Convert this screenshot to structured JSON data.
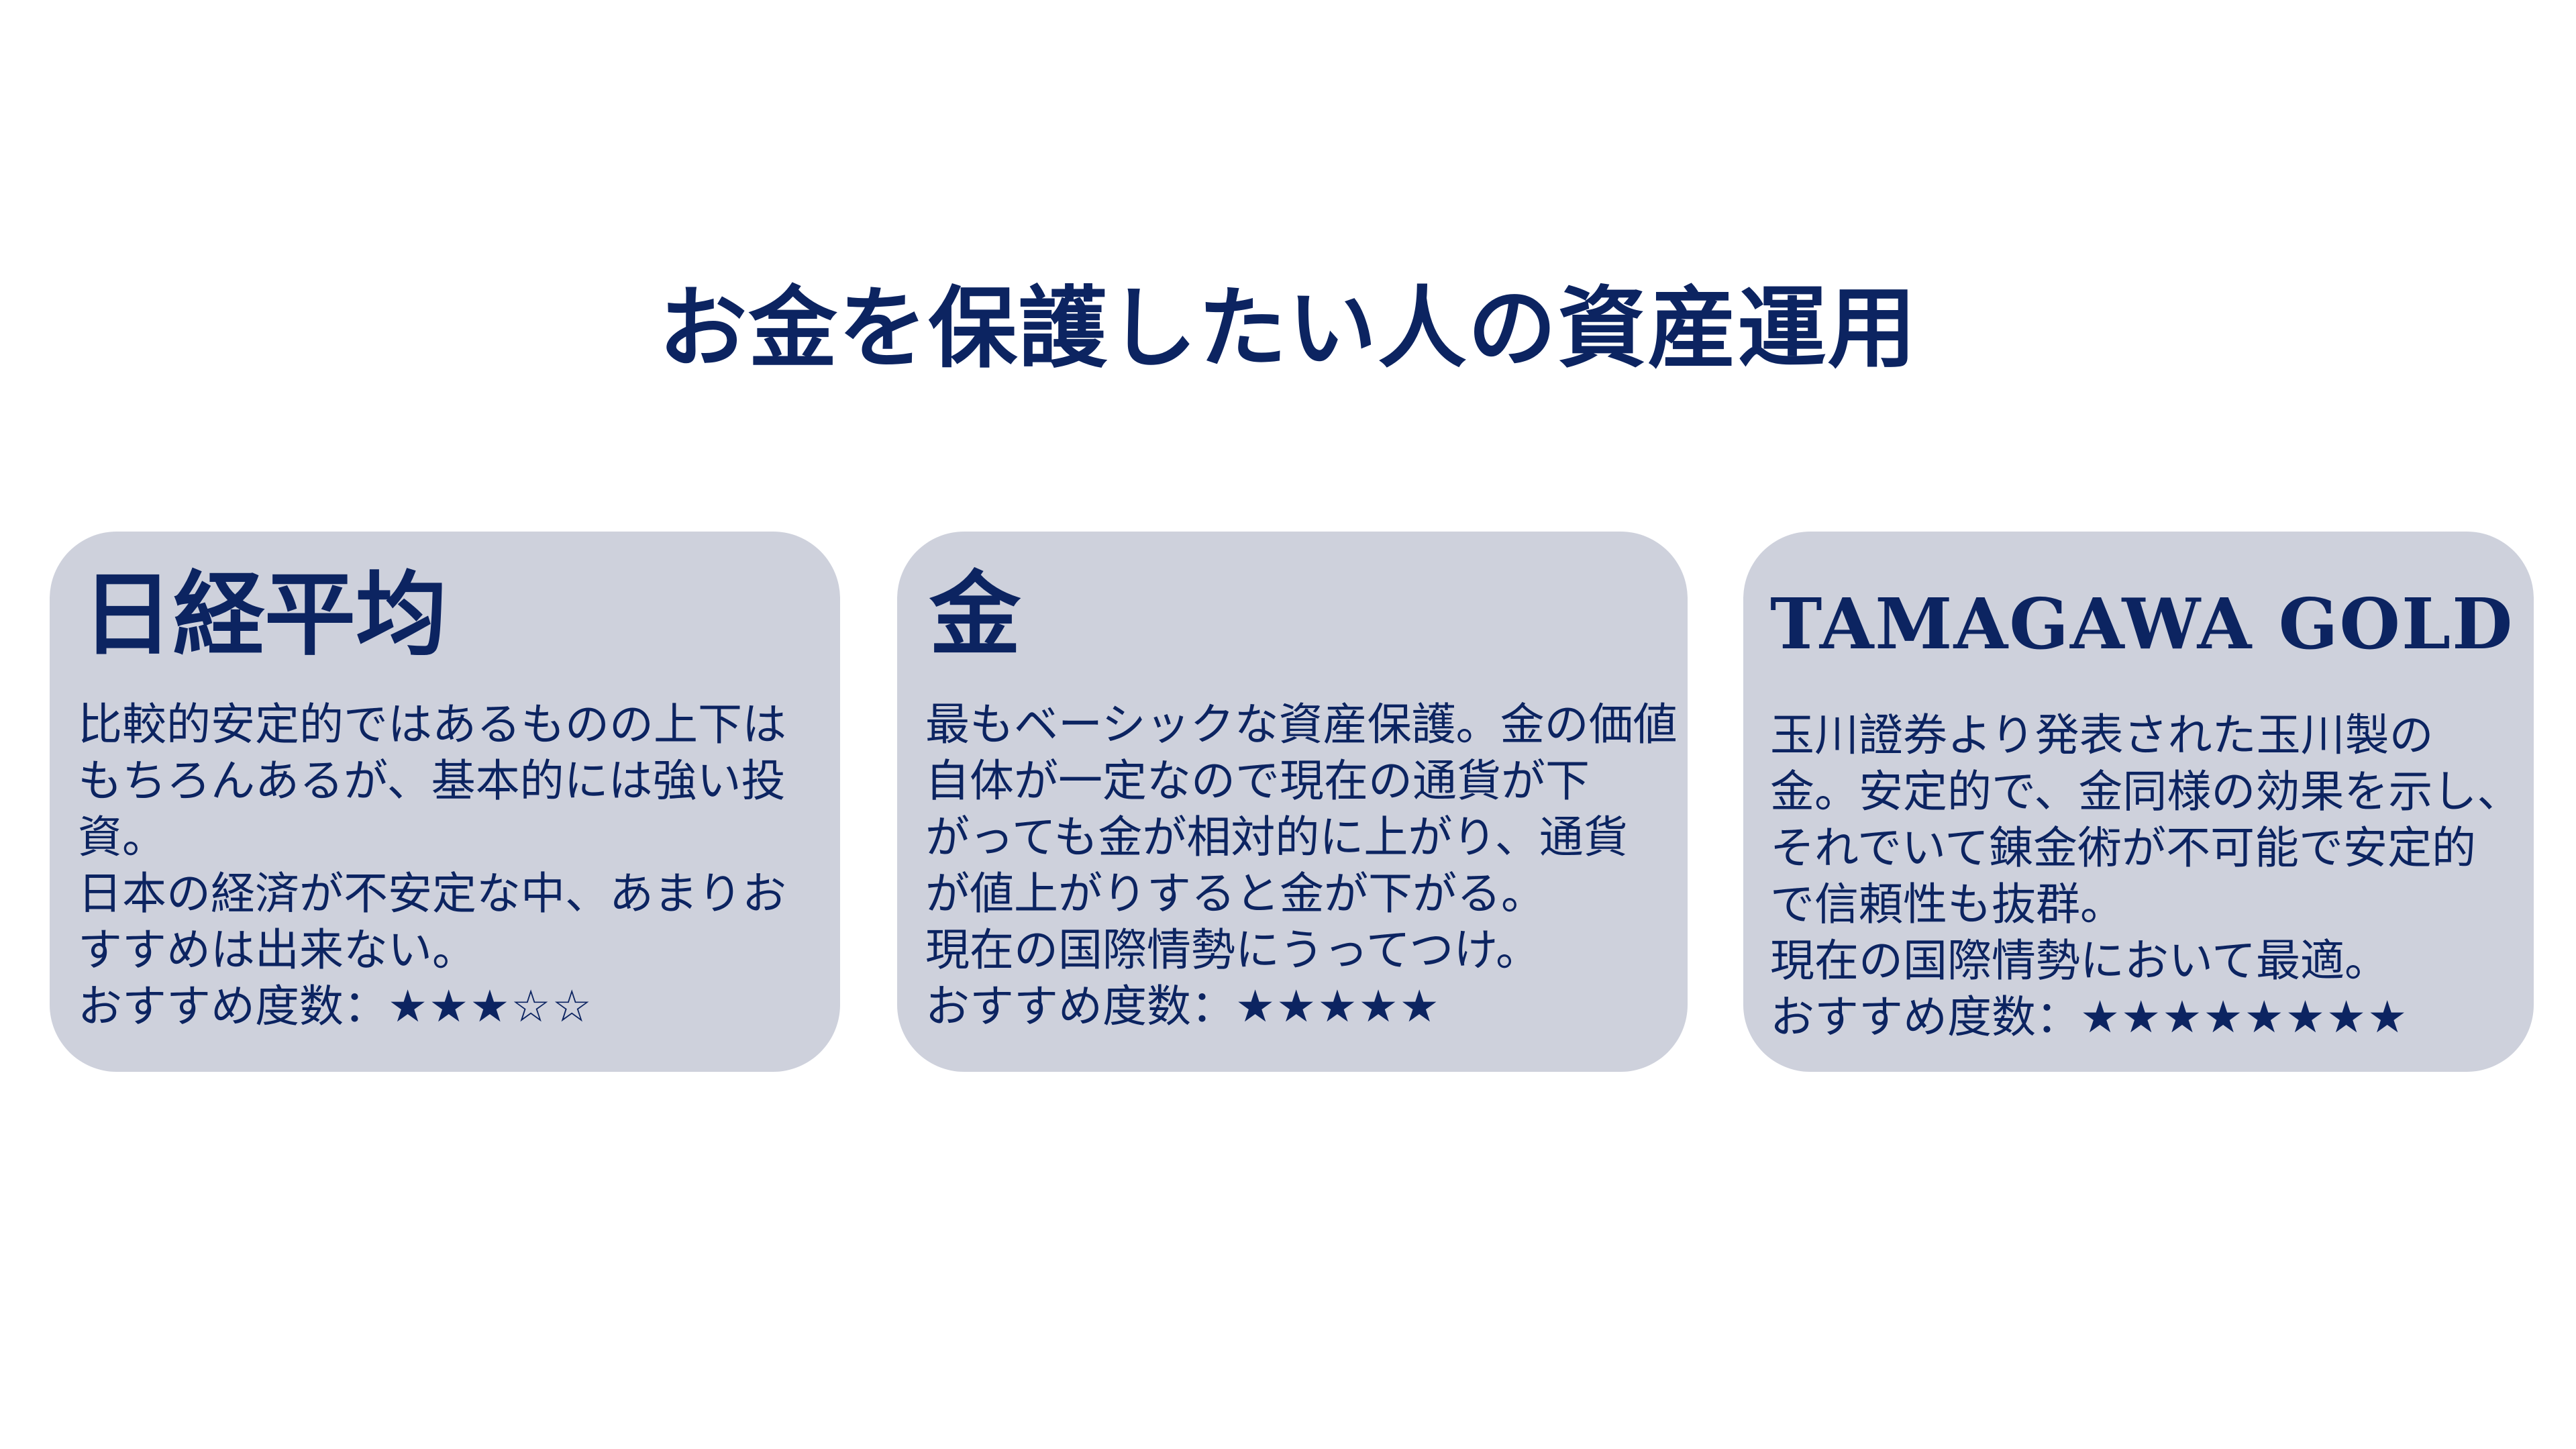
{
  "page": {
    "title": "お金を保護したい人の資産運用"
  },
  "colors": {
    "text": "#0c2461",
    "card_background": "#ced1dc",
    "page_background": "#ffffff"
  },
  "cards": [
    {
      "title": "日経平均",
      "lines": [
        "比較的安定的ではあるものの上下は",
        "もちろんあるが、基本的には強い投",
        "資。",
        "日本の経済が不安定な中、あまりお",
        "すすめは出来ない。"
      ],
      "rating_label": "おすすめ度数：",
      "rating_stars": "★★★☆☆"
    },
    {
      "title": "金",
      "lines": [
        "最もベーシックな資産保護。金の価値",
        "自体が一定なので現在の通貨が下",
        "がっても金が相対的に上がり、通貨",
        "が値上がりすると金が下がる。",
        "現在の国際情勢にうってつけ。"
      ],
      "rating_label": "おすすめ度数：",
      "rating_stars": "★★★★★"
    },
    {
      "title": "TAMAGAWA GOLD",
      "lines": [
        "玉川證券より発表された玉川製の",
        "金。安定的で、金同様の効果を示し、",
        "それでいて錬金術が不可能で安定的",
        "で信頼性も抜群。",
        "現在の国際情勢において最適。"
      ],
      "rating_label": "おすすめ度数：",
      "rating_stars": "★★★★★★★★"
    }
  ]
}
